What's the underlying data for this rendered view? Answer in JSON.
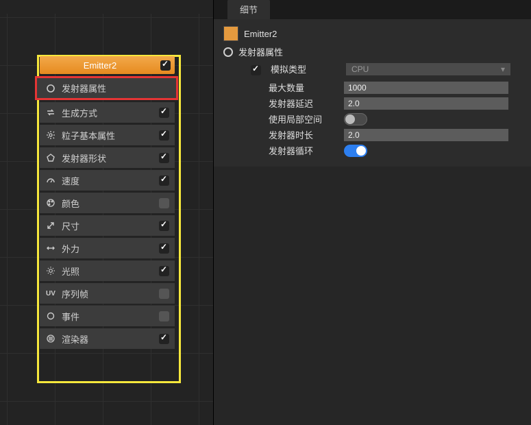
{
  "left": {
    "emitter_title": "Emitter2",
    "emitter_checked": true,
    "modules": [
      {
        "icon": "circle",
        "label": "发射器属性",
        "checked": null,
        "highlight": true
      },
      {
        "icon": "swap",
        "label": "生成方式",
        "checked": true
      },
      {
        "icon": "spark",
        "label": "粒子基本属性",
        "checked": true
      },
      {
        "icon": "pentagon",
        "label": "发射器形状",
        "checked": true
      },
      {
        "icon": "gauge",
        "label": "速度",
        "checked": true
      },
      {
        "icon": "palette",
        "label": "颜色",
        "checked": false
      },
      {
        "icon": "resize",
        "label": "尺寸",
        "checked": true
      },
      {
        "icon": "arrows",
        "label": "外力",
        "checked": true
      },
      {
        "icon": "sun",
        "label": "光照",
        "checked": true
      },
      {
        "icon": "uv",
        "label": "序列帧",
        "checked": false
      },
      {
        "icon": "event",
        "label": "事件",
        "checked": false
      },
      {
        "icon": "render",
        "label": "渲染器",
        "checked": true
      }
    ]
  },
  "right": {
    "tab": "细节",
    "object_name": "Emitter2",
    "section_title": "发射器属性",
    "section_checked": true,
    "props": {
      "sim_type_label": "模拟类型",
      "sim_type_value": "CPU",
      "max_count_label": "最大数量",
      "max_count_value": "1000",
      "delay_label": "发射器延迟",
      "delay_value": "2.0",
      "local_space_label": "使用局部空间",
      "local_space_value": false,
      "duration_label": "发射器时长",
      "duration_value": "2.0",
      "loop_label": "发射器循环",
      "loop_value": true
    }
  }
}
